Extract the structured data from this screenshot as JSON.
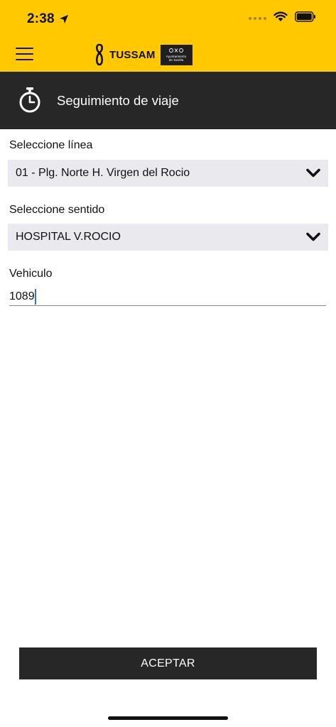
{
  "status_bar": {
    "time": "2:38"
  },
  "header": {
    "logo_text": "TUSSAM",
    "badge_line1": "Ayuntamiento",
    "badge_line2": "de Sevilla"
  },
  "title_bar": {
    "title": "Seguimiento de viaje"
  },
  "form": {
    "line_label": "Seleccione línea",
    "line_value": "01 - Plg. Norte H. Virgen del Rocio",
    "direction_label": "Seleccione sentido",
    "direction_value": "HOSPITAL V.ROCIO",
    "vehicle_label": "Vehiculo",
    "vehicle_value": "1089"
  },
  "actions": {
    "accept_label": "ACEPTAR"
  },
  "colors": {
    "brand_yellow": "#ffc800",
    "dark_bar": "#272727",
    "select_bg": "#eaeaee",
    "caret": "#2f6df6"
  }
}
